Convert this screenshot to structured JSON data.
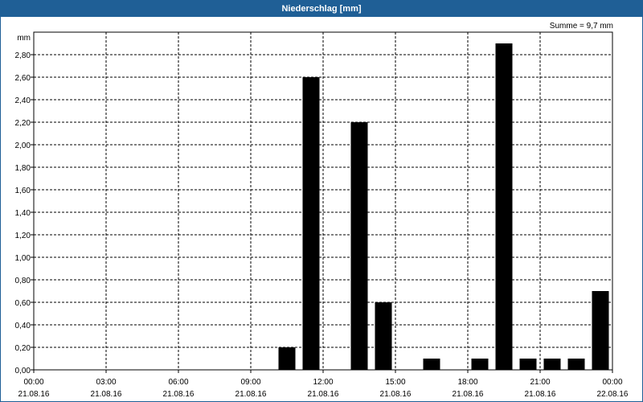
{
  "window": {
    "title": "Niederschlag [mm]"
  },
  "summary": "Summe = 9,7 mm",
  "chart_data": {
    "type": "bar",
    "title": "Niederschlag [mm]",
    "ylabel": "mm",
    "xlabel": "",
    "ylim": [
      0,
      3.0
    ],
    "yticks": [
      0,
      0.2,
      0.4,
      0.6,
      0.8,
      1.0,
      1.2,
      1.4,
      1.6,
      1.8,
      2.0,
      2.2,
      2.4,
      2.6,
      2.8
    ],
    "ytick_labels": [
      "0,00",
      "0,20",
      "0,40",
      "0,60",
      "0,80",
      "1,00",
      "1,20",
      "1,40",
      "1,60",
      "1,80",
      "2,00",
      "2,20",
      "2,40",
      "2,60",
      "2,80"
    ],
    "xlim_hours": [
      0,
      24
    ],
    "xticks": [
      {
        "hour": 0,
        "time": "00:00",
        "date": "21.08.16"
      },
      {
        "hour": 3,
        "time": "03:00",
        "date": "21.08.16"
      },
      {
        "hour": 6,
        "time": "06:00",
        "date": "21.08.16"
      },
      {
        "hour": 9,
        "time": "09:00",
        "date": "21.08.16"
      },
      {
        "hour": 12,
        "time": "12:00",
        "date": "21.08.16"
      },
      {
        "hour": 15,
        "time": "15:00",
        "date": "21.08.16"
      },
      {
        "hour": 18,
        "time": "18:00",
        "date": "21.08.16"
      },
      {
        "hour": 21,
        "time": "21:00",
        "date": "21.08.16"
      },
      {
        "hour": 24,
        "time": "00:00",
        "date": "22.08.16"
      }
    ],
    "bars": [
      {
        "hour": 10.5,
        "value": 0.2
      },
      {
        "hour": 11.5,
        "value": 2.6
      },
      {
        "hour": 13.5,
        "value": 2.2
      },
      {
        "hour": 14.5,
        "value": 0.6
      },
      {
        "hour": 16.5,
        "value": 0.1
      },
      {
        "hour": 18.5,
        "value": 0.1
      },
      {
        "hour": 19.5,
        "value": 2.9
      },
      {
        "hour": 20.5,
        "value": 0.1
      },
      {
        "hour": 21.5,
        "value": 0.1
      },
      {
        "hour": 22.5,
        "value": 0.1
      },
      {
        "hour": 23.5,
        "value": 0.7
      }
    ],
    "grid": true,
    "bar_color": "#000000"
  }
}
